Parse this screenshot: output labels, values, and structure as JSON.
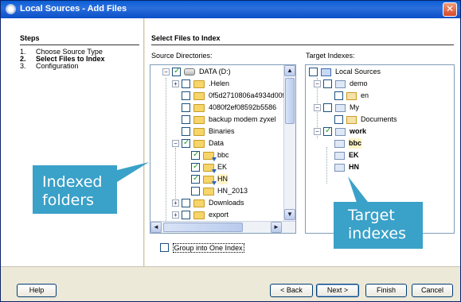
{
  "window": {
    "title": "Local Sources - Add Files",
    "close_glyph": "✕"
  },
  "steps": {
    "title": "Steps",
    "items": [
      {
        "num": "1.",
        "label": "Choose Source Type"
      },
      {
        "num": "2.",
        "label": "Select Files to Index"
      },
      {
        "num": "3.",
        "label": "Configuration"
      }
    ]
  },
  "main": {
    "title": "Select Files to Index",
    "source_label": "Source Directories:",
    "target_label": "Target Indexes:",
    "source_tree": [
      {
        "label": "DATA (D:)",
        "checked": true,
        "icon": "drive-icon"
      },
      {
        "label": ".Helen",
        "checked": false,
        "icon": "folder-icon"
      },
      {
        "label": "0f5d2710806a4934d00fb",
        "checked": false,
        "icon": "folder-icon"
      },
      {
        "label": "4080f2ef08592b5586",
        "checked": false,
        "icon": "folder-icon"
      },
      {
        "label": "backup modem zyxel",
        "checked": false,
        "icon": "folder-icon"
      },
      {
        "label": "Binaries",
        "checked": false,
        "icon": "folder-icon"
      },
      {
        "label": "Data",
        "checked": true,
        "icon": "folder-icon"
      },
      {
        "label": "bbc",
        "checked": true,
        "icon": "indexed-folder-icon"
      },
      {
        "label": "EK",
        "checked": true,
        "icon": "indexed-folder-icon"
      },
      {
        "label": "HN",
        "checked": true,
        "icon": "indexed-folder-icon"
      },
      {
        "label": "HN_2013",
        "checked": false,
        "icon": "folder-icon"
      },
      {
        "label": "Downloads",
        "checked": false,
        "icon": "folder-icon"
      },
      {
        "label": "export",
        "checked": false,
        "icon": "folder-icon"
      }
    ],
    "target_tree": [
      {
        "label": "Local Sources",
        "checked": false
      },
      {
        "label": "demo",
        "checked": false
      },
      {
        "label": "en",
        "checked": false
      },
      {
        "label": "My",
        "checked": false
      },
      {
        "label": "Documents",
        "checked": false
      },
      {
        "label": "work",
        "checked": true
      },
      {
        "label": "bbc"
      },
      {
        "label": "EK"
      },
      {
        "label": "HN"
      }
    ],
    "group_checkbox_label": "Group into One Index",
    "scroll_up": "▲",
    "scroll_down": "▼",
    "scroll_left": "◄",
    "scroll_right": "►"
  },
  "buttons": {
    "help": "Help",
    "back": "< Back",
    "next": "Next >",
    "finish": "Finish",
    "cancel": "Cancel"
  },
  "callouts": {
    "indexed_folders": [
      "Indexed",
      "folders"
    ],
    "target_indexes": [
      "Target",
      "indexes"
    ]
  },
  "colors": {
    "title_bar": "#0a5ed6",
    "callout": "#3aa1c8",
    "checkmark": "#21a121"
  }
}
